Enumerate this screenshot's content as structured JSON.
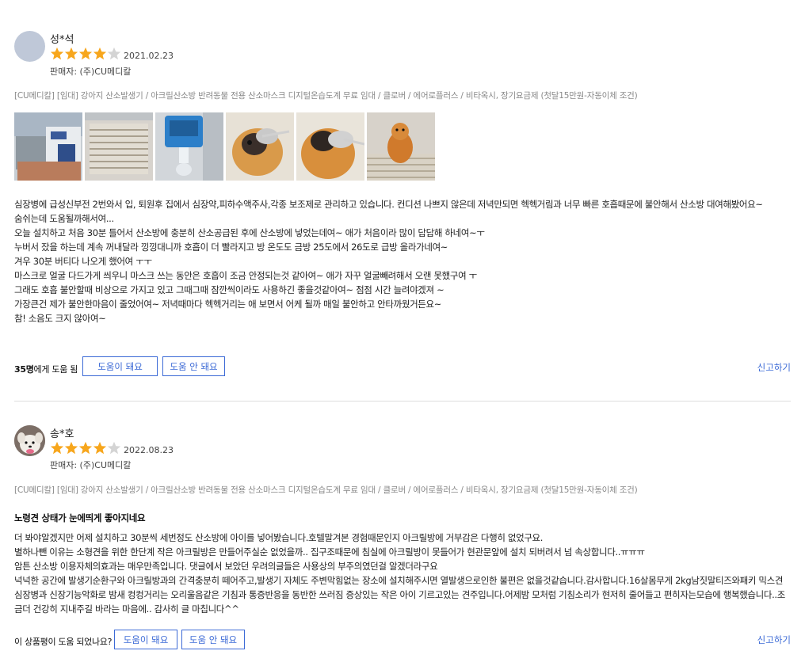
{
  "reviews": [
    {
      "author": "성*석",
      "rating": 4,
      "rating_max": 5,
      "date": "2021.02.23",
      "seller": "판매자: (주)CU메디칼",
      "product": "[CU메디칼] [임대] 강아지 산소발생기 / 아크릴산소방 반려동물 전용 산소마스크 디지털온습도계 무료 임대 / 클로버 / 에어로플러스 / 비타옥시, 장기요금제 (첫달15만원-자동이체 조건)",
      "photos": [
        "machine-photo",
        "mat-photo",
        "oxygen-tank-photo",
        "dog-mask-photo",
        "dog-mask-closeup-photo",
        "dog-standing-photo"
      ],
      "body_lines": [
        "심장병에 급성신부전 2번와서 입, 퇴원후 집에서 심장약,피하수액주사,각종 보조제로 관리하고 있습니다. 컨디션 나쁘지 않은데 저녁만되면 헥헥거림과 너무 빠른 호흡때문에 불안해서 산소방 대여해봤어요~",
        "숨쉬는데 도움될까해서여...",
        "오늘 설치하고 처음 30분 틀어서 산소방에 충분히 산소공급된 후에 산소방에 넣었는데여~ 애가 처음이라 많이 답답해 하네여~ㅜ",
        "누버서 잤을 하는데 계속 꺼내달라 낑낑대니까 호흡이 더 빨라지고 방 온도도 금방 25도에서 26도로 급방 올라가네여~",
        "겨우 30분 버티다 나오게 했어여 ㅜㅜ",
        "마스크로 얼굴 다드가게 씌우니 마스크 쓰는 동안은 호흡이 조금 안정되는것 같아여~ 애가 자꾸 얼굴빼려해서 오랜 못했구여 ㅜ",
        "그래도 호흡 불안할때 비상으로 가지고 있고 그때그때 잠깐씩이라도 사용하긴 좋을것같아여~ 점점 시간 늘려야겠져 ~",
        "가장큰건 제가 불안한마음이 줄었어여~ 저녁때마다 헥헥거리는 애 보면서 어케 될까 매일 불안하고 안타까웠거든요~",
        "참! 소음도 크지 않아여~"
      ],
      "helpful_count": "35명",
      "helpful_suffix": "에게 도움 됨",
      "btn_helpful": "도움이 돼요",
      "btn_not_helpful": "도움 안 돼요",
      "report": "신고하기"
    },
    {
      "author": "송*호",
      "rating": 4,
      "rating_max": 5,
      "date": "2022.08.23",
      "seller": "판매자: (주)CU메디칼",
      "product": "[CU메디칼] [임대] 강아지 산소발생기 / 아크릴산소방 반려동물 전용 산소마스크 디지털온습도계 무료 임대 / 클로버 / 에어로플러스 / 비타옥시, 장기요금제 (첫달15만원-자동이체 조건)",
      "headline": "노령견 상태가 눈에띄게 좋아지네요",
      "body_lines": [
        "더 봐야알겠지만 어제 설치하고 30분씩 세번정도 산소방에 아이를 넣어봤습니다.호텔말겨본 경험때문인지 아크릴방에 거부감은 다행히 없었구요.",
        "별하나뺀 이유는 소형견을 위한 한단계 작은 아크릴방은 만들어주실순 없었을까.. 집구조때문에 침실에 아크릴방이 못들어가 현관문앞에 설치 되버려서 넘 속상합니다..ㅠㅠㅠ",
        "암튼 산소방 이용자체의효과는 매우만족입니다. 댓글에서 보았던 우려의글들은 사용상의 부주의였던걸 알겠더라구요",
        "넉넉한 공간에 발생기순환구와 아크릴방과의 간격충분히 떼어주고,발생기 자체도 주변막힘없는 장소에 설치해주시면 열발생으로인한 불편은 없을것같습니다.감사합니다.16살몸무게 2kg남짓말티즈와패키 믹스견 심장병과 신장기능악화로 밤새 컹컹거리는 오리울음같은 기침과 통증반응을 동반한 쓰러짐 증상있는 작은 아이 기르고있는 견주입니다.어제밤 모처럼 기침소리가 현저히 줄어들고 편히자는모습에 행복했습니다..조금더 건강히 지내주길 바라는 마음에.. 감사히 글 마칩니다^^"
      ],
      "helpful_question": "이 상품평이 도움 되었나요?",
      "btn_helpful": "도움이 돼요",
      "btn_not_helpful": "도움 안 돼요",
      "report": "신고하기"
    }
  ],
  "colors": {
    "star_on": "#f7a61c",
    "star_off": "#d4d4d4",
    "accent": "#3c6ad6"
  }
}
